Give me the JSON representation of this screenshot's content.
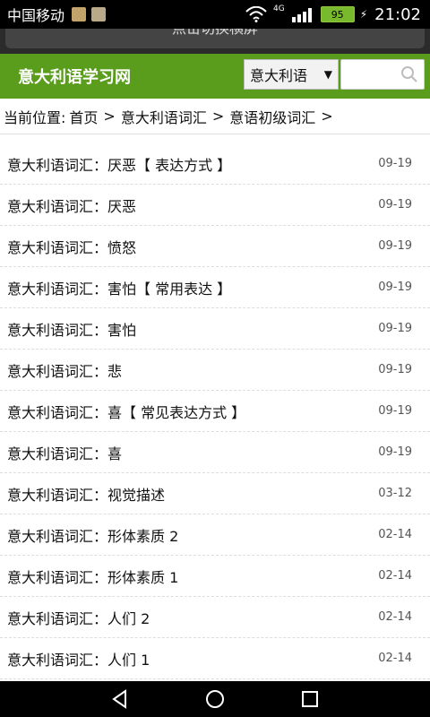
{
  "statusbar": {
    "carrier": "中国移动",
    "network": "4G",
    "battery": "95",
    "time": "21:02"
  },
  "rotate": {
    "label": "点击切换横屏"
  },
  "header": {
    "site_title": "意大利语学习网",
    "lang_select": "意大利语",
    "brand_color": "#5a9d1d"
  },
  "breadcrumb": {
    "prefix": "当前位置:",
    "items": [
      "首页",
      "意大利语词汇",
      "意语初级词汇"
    ],
    "sep": ">"
  },
  "list": [
    {
      "title": "意大利语词汇：厌恶【 表达方式 】",
      "date": "09-19"
    },
    {
      "title": "意大利语词汇：厌恶",
      "date": "09-19"
    },
    {
      "title": "意大利语词汇：愤怒",
      "date": "09-19"
    },
    {
      "title": "意大利语词汇：害怕【 常用表达 】",
      "date": "09-19"
    },
    {
      "title": "意大利语词汇：害怕",
      "date": "09-19"
    },
    {
      "title": "意大利语词汇：悲",
      "date": "09-19"
    },
    {
      "title": "意大利语词汇：喜【 常见表达方式 】",
      "date": "09-19"
    },
    {
      "title": "意大利语词汇：喜",
      "date": "09-19"
    },
    {
      "title": "意大利语词汇：视觉描述",
      "date": "03-12"
    },
    {
      "title": "意大利语词汇：形体素质 2",
      "date": "02-14"
    },
    {
      "title": "意大利语词汇：形体素质 1",
      "date": "02-14"
    },
    {
      "title": "意大利语词汇：人们 2",
      "date": "02-14"
    },
    {
      "title": "意大利语词汇：人们 1",
      "date": "02-14"
    }
  ]
}
